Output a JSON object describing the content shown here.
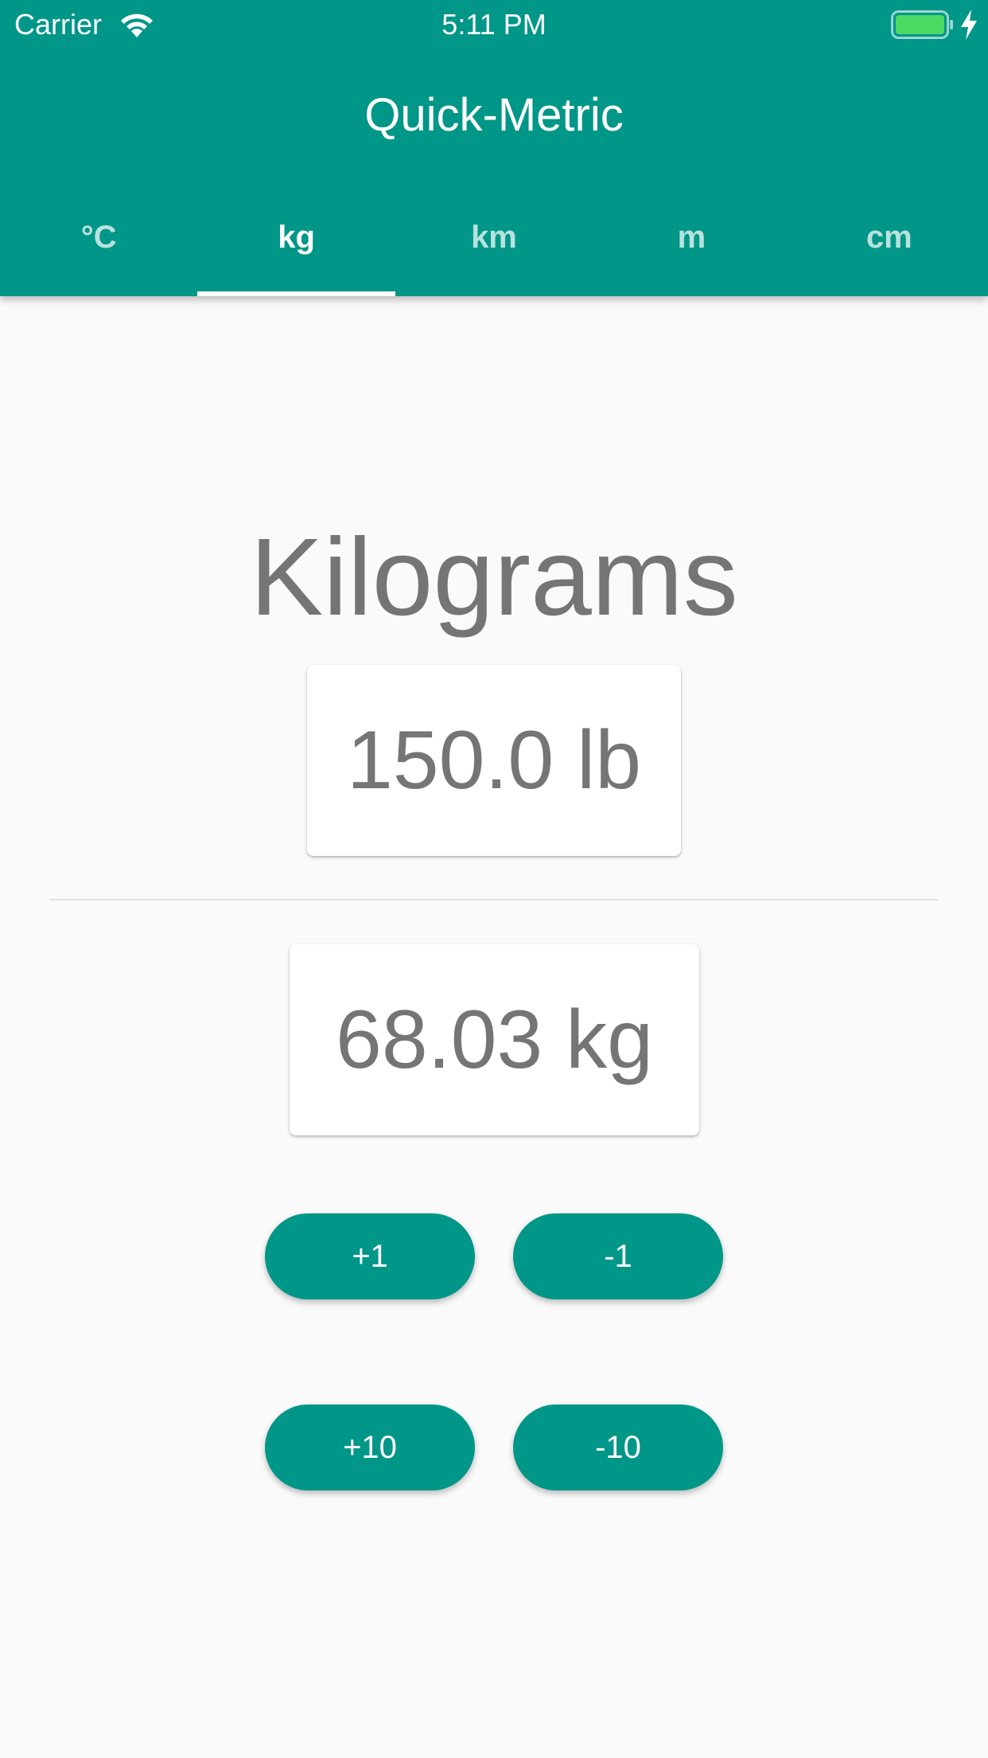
{
  "status_bar": {
    "carrier": "Carrier",
    "time": "5:11 PM",
    "battery_color": "#4cd964"
  },
  "app": {
    "title": "Quick-Metric",
    "accent_color": "#009688"
  },
  "tabs": [
    {
      "label": "°C",
      "active": false
    },
    {
      "label": "kg",
      "active": true
    },
    {
      "label": "km",
      "active": false
    },
    {
      "label": "m",
      "active": false
    },
    {
      "label": "cm",
      "active": false
    }
  ],
  "converter": {
    "heading": "Kilograms",
    "input_value": "150.0 lb",
    "output_value": "68.03 kg"
  },
  "buttons": {
    "plus_one": "+1",
    "minus_one": "-1",
    "plus_ten": "+10",
    "minus_ten": "-10"
  }
}
